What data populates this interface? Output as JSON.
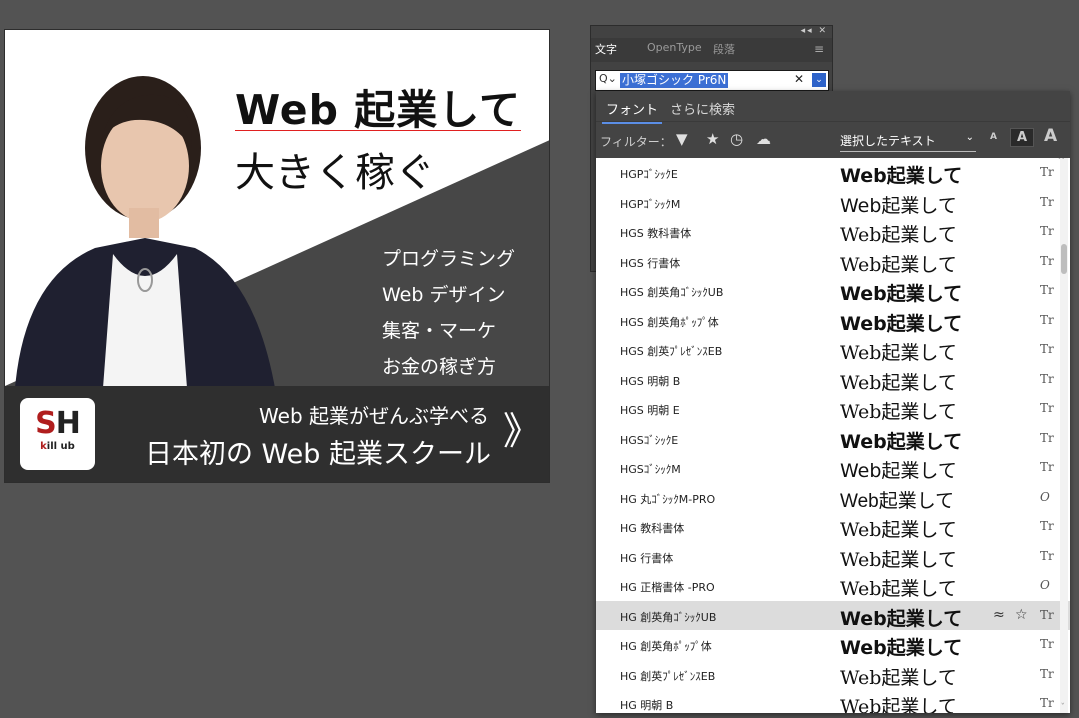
{
  "banner": {
    "headline_line1": "Web 起業して",
    "headline_line2": "大きく稼ぐ",
    "services": [
      "プログラミング",
      "Web デザイン",
      "集客・マーケ",
      "お金の稼ぎ方"
    ],
    "logo_big_s": "S",
    "logo_big_h": "H",
    "logo_small_k": "k",
    "logo_small_rest": "ill ub",
    "tagline1": "Web 起業がぜんぶ学べる",
    "tagline2": "日本初の Web 起業スクール",
    "arrow": "》"
  },
  "char_panel": {
    "tabs": [
      "文字",
      "OpenType",
      "段落"
    ],
    "collapse": "◂◂ ✕",
    "menu": "≡",
    "search_value": "小塚ゴシック Pr6N",
    "search_icon": "Q⌄",
    "clear": "✕",
    "dropdown": "⌄"
  },
  "font_dropdown": {
    "tabs": [
      "フォント",
      "さらに検索"
    ],
    "filter_label": "フィルター：",
    "filter_icons": [
      "filter-icon",
      "star-icon",
      "clock-icon",
      "cloud-icon"
    ],
    "preview_select": "選択したテキスト",
    "size_small": "A",
    "size_mid": "A",
    "size_large": "A",
    "fonts": [
      {
        "name": "HGPｺﾞｼｯｸE",
        "sample": "Web起業して",
        "style": "bold",
        "type": "Tr"
      },
      {
        "name": "HGPｺﾞｼｯｸM",
        "sample": "Web起業して",
        "style": "normal",
        "type": "Tr"
      },
      {
        "name": "HGS 教科書体",
        "sample": "Web起業して",
        "style": "serif",
        "type": "Tr"
      },
      {
        "name": "HGS 行書体",
        "sample": "Web起業して",
        "style": "serif",
        "type": "Tr"
      },
      {
        "name": "HGS 創英角ｺﾞｼｯｸUB",
        "sample": "Web起業して",
        "style": "bold",
        "type": "Tr"
      },
      {
        "name": "HGS 創英角ﾎﾟｯﾌﾟ体",
        "sample": "Web起業して",
        "style": "bold",
        "type": "Tr"
      },
      {
        "name": "HGS 創英ﾌﾟﾚｾﾞﾝｽEB",
        "sample": "Web起業して",
        "style": "serif",
        "type": "Tr"
      },
      {
        "name": "HGS 明朝 B",
        "sample": "Web起業して",
        "style": "serif",
        "type": "Tr"
      },
      {
        "name": "HGS 明朝 E",
        "sample": "Web起業して",
        "style": "serif",
        "type": "Tr"
      },
      {
        "name": "HGSｺﾞｼｯｸE",
        "sample": "Web起業して",
        "style": "bold",
        "type": "Tr"
      },
      {
        "name": "HGSｺﾞｼｯｸM",
        "sample": "Web起業して",
        "style": "normal",
        "type": "Tr"
      },
      {
        "name": "HG 丸ｺﾞｼｯｸM-PRO",
        "sample": "Web起業して",
        "style": "thin",
        "type": "O"
      },
      {
        "name": "HG 教科書体",
        "sample": "Web起業して",
        "style": "serif",
        "type": "Tr"
      },
      {
        "name": "HG 行書体",
        "sample": "Web起業して",
        "style": "serif",
        "type": "Tr"
      },
      {
        "name": "HG 正楷書体 -PRO",
        "sample": "Web起業して",
        "style": "serif",
        "type": "O"
      },
      {
        "name": "HG 創英角ｺﾞｼｯｸUB",
        "sample": "Web起業して",
        "style": "bold",
        "type": "Tr",
        "highlight": true
      },
      {
        "name": "HG 創英角ﾎﾟｯﾌﾟ体",
        "sample": "Web起業して",
        "style": "bold",
        "type": "Tr"
      },
      {
        "name": "HG 創英ﾌﾟﾚｾﾞﾝｽEB",
        "sample": "Web起業して",
        "style": "serif",
        "type": "Tr"
      },
      {
        "name": "HG 明朝 B",
        "sample": "Web起業して",
        "style": "serif",
        "type": "Tr"
      }
    ],
    "highlight_approx": "≈",
    "highlight_star": "☆"
  }
}
